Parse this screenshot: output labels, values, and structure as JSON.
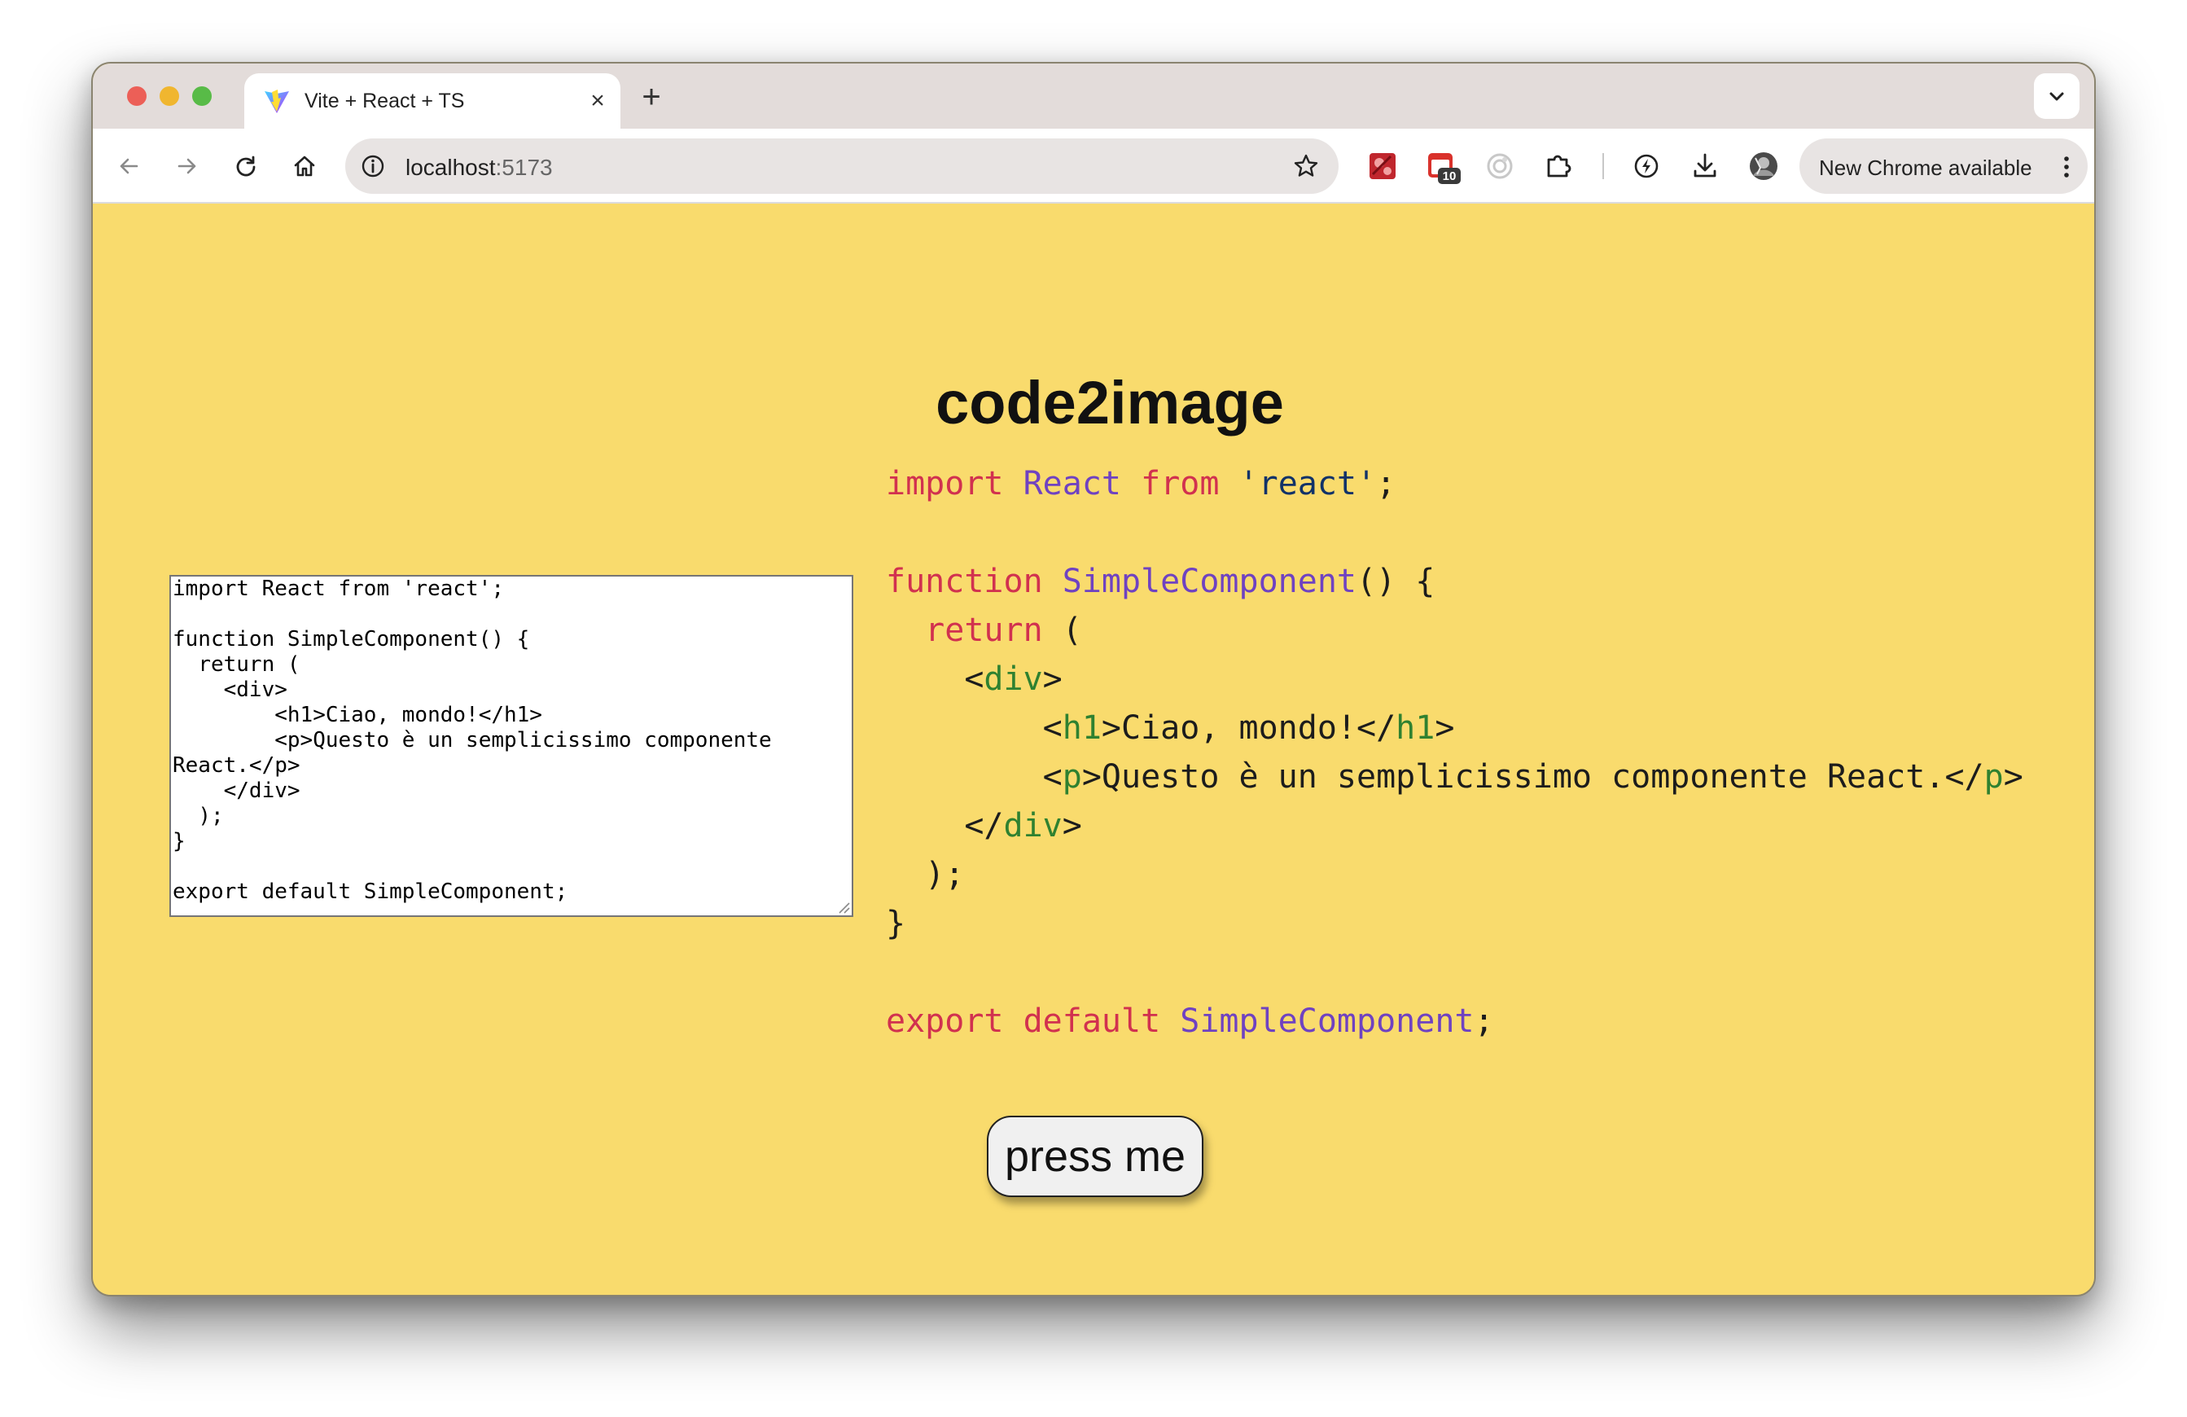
{
  "browser": {
    "tab": {
      "title": "Vite + React + TS",
      "close_glyph": "×"
    },
    "new_tab_glyph": "+",
    "omnibox": {
      "host": "localhost",
      "port": ":5173"
    },
    "extensions": [
      {
        "name": "extension-red-puzzle-icon"
      },
      {
        "name": "extension-calendar-icon",
        "badge": "10"
      },
      {
        "name": "extension-grey-circle-icon"
      },
      {
        "name": "extensions-puzzle-icon"
      },
      {
        "name": "performance-bolt-icon"
      },
      {
        "name": "download-icon"
      },
      {
        "name": "profile-avatar"
      }
    ],
    "update_button": {
      "label": "New Chrome available"
    }
  },
  "page": {
    "title": "code2image",
    "editor_text": "import React from 'react';\n\nfunction SimpleComponent() {\n  return (\n    <div>\n        <h1>Ciao, mondo!</h1>\n        <p>Questo è un semplicissimo componente React.</p>\n    </div>\n  );\n}\n\nexport default SimpleComponent;",
    "code_lines": [
      [
        {
          "t": "import",
          "c": "kw"
        },
        {
          "t": " ",
          "c": "plain"
        },
        {
          "t": "React",
          "c": "name"
        },
        {
          "t": " ",
          "c": "plain"
        },
        {
          "t": "from",
          "c": "kw"
        },
        {
          "t": " ",
          "c": "plain"
        },
        {
          "t": "'react'",
          "c": "str"
        },
        {
          "t": ";",
          "c": "plain"
        }
      ],
      [],
      [
        {
          "t": "function",
          "c": "kw"
        },
        {
          "t": " ",
          "c": "plain"
        },
        {
          "t": "SimpleComponent",
          "c": "name"
        },
        {
          "t": "() {",
          "c": "plain"
        }
      ],
      [
        {
          "t": "  ",
          "c": "plain"
        },
        {
          "t": "return",
          "c": "kw"
        },
        {
          "t": " (",
          "c": "plain"
        }
      ],
      [
        {
          "t": "    <",
          "c": "plain"
        },
        {
          "t": "div",
          "c": "tag"
        },
        {
          "t": ">",
          "c": "plain"
        }
      ],
      [
        {
          "t": "        <",
          "c": "plain"
        },
        {
          "t": "h1",
          "c": "tag"
        },
        {
          "t": ">Ciao, mondo!</",
          "c": "plain"
        },
        {
          "t": "h1",
          "c": "tag"
        },
        {
          "t": ">",
          "c": "plain"
        }
      ],
      [
        {
          "t": "        <",
          "c": "plain"
        },
        {
          "t": "p",
          "c": "tag"
        },
        {
          "t": ">Questo è un semplicissimo componente React.</",
          "c": "plain"
        },
        {
          "t": "p",
          "c": "tag"
        },
        {
          "t": ">",
          "c": "plain"
        }
      ],
      [
        {
          "t": "    </",
          "c": "plain"
        },
        {
          "t": "div",
          "c": "tag"
        },
        {
          "t": ">",
          "c": "plain"
        }
      ],
      [
        {
          "t": "  );",
          "c": "plain"
        }
      ],
      [
        {
          "t": "}",
          "c": "plain"
        }
      ],
      [],
      [
        {
          "t": "export",
          "c": "kw"
        },
        {
          "t": " ",
          "c": "plain"
        },
        {
          "t": "default",
          "c": "kw"
        },
        {
          "t": " ",
          "c": "plain"
        },
        {
          "t": "SimpleComponent",
          "c": "name"
        },
        {
          "t": ";",
          "c": "plain"
        }
      ]
    ],
    "button_label": "press me"
  },
  "colors": {
    "page_background": "#f9db6d",
    "keyword": "#d1314f",
    "identifier": "#6f42c1",
    "string": "#113268",
    "jsx_tag": "#2f8130"
  }
}
